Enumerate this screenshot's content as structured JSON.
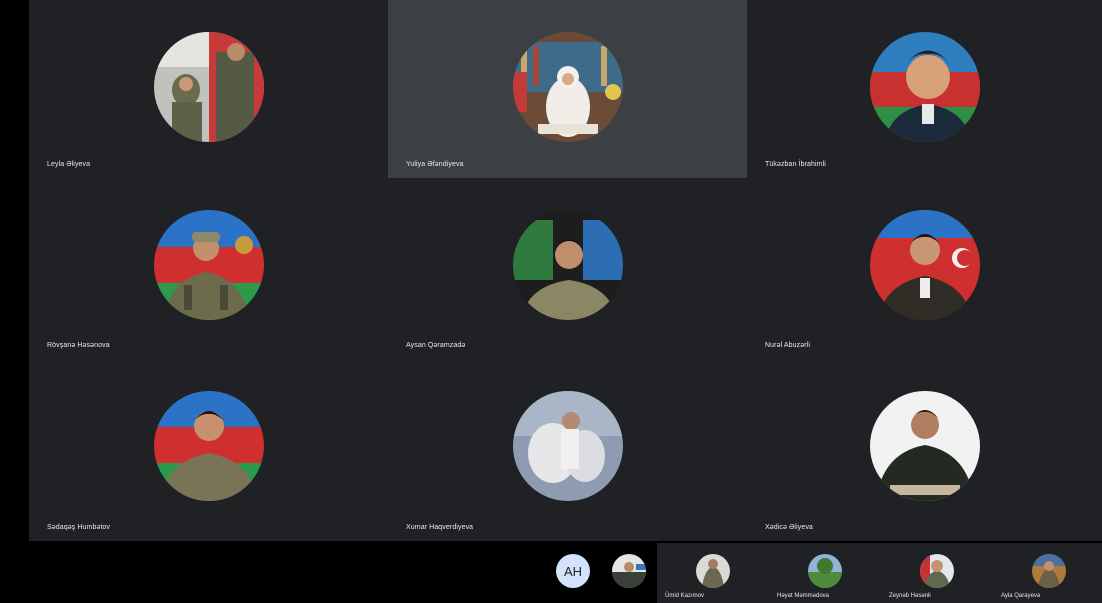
{
  "participants": [
    {
      "name": "Leyla Əliyeva",
      "active": false,
      "photo": "soldier-photo-1"
    },
    {
      "name": "Yuliya Əfəndiyeva",
      "active": true,
      "photo": "woman-library-photo"
    },
    {
      "name": "Tükəzban İbrahimli",
      "active": false,
      "photo": "officer-flag-photo"
    },
    {
      "name": "Rövşanə Həsənova",
      "active": false,
      "photo": "soldier-flag-photo"
    },
    {
      "name": "Aysan Qəramzadə",
      "active": false,
      "photo": "soldier-flag-photo-2"
    },
    {
      "name": "Nurəl Abuzərli",
      "active": false,
      "photo": "uniform-flag-photo"
    },
    {
      "name": "Sədaqəş Humbətov",
      "active": false,
      "photo": "soldier-flag-photo-3"
    },
    {
      "name": "Xumar Haqverdiyeva",
      "active": false,
      "photo": "woman-dress-photo"
    },
    {
      "name": "Xədicə Əliyeva",
      "active": false,
      "photo": "officer-photo"
    }
  ],
  "bottom_strip": {
    "self_initials": "AH",
    "tiles": [
      {
        "name": "Ümid Kazımov"
      },
      {
        "name": "Həyat Məmmədova"
      },
      {
        "name": "Zeynəb Həsənli"
      },
      {
        "name": "Ayla Qarayeva"
      }
    ]
  },
  "colors": {
    "tile_bg": "#202124",
    "active_tile_bg": "#3c4043",
    "self_avatar_bg": "#d3e3fd",
    "text": "#e8eaed"
  }
}
